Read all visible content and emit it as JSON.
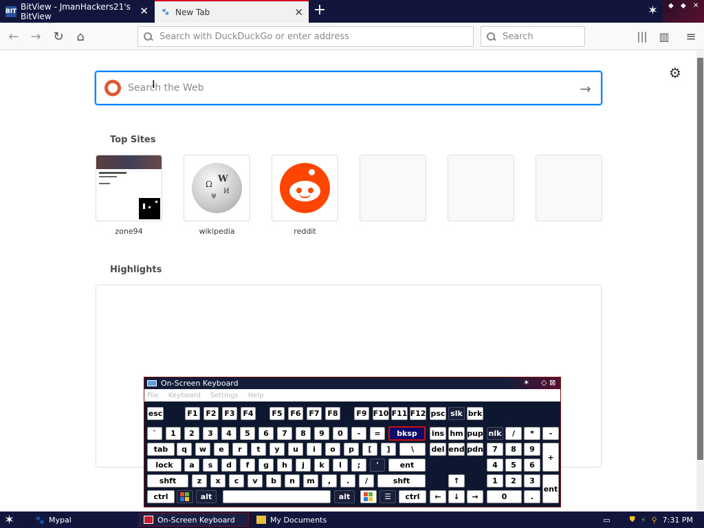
{
  "browser": {
    "tabs": [
      {
        "title": "BitView - JmanHackers21's BitView",
        "favicon_text": "BIT"
      },
      {
        "title": "New Tab"
      }
    ],
    "urlbar_placeholder": "Search with DuckDuckGo or enter address",
    "searchbar_placeholder": "Search"
  },
  "newtab": {
    "search_placeholder": "Search the Web",
    "top_sites_title": "Top Sites",
    "top_sites": [
      {
        "label": "zone94"
      },
      {
        "label": "wikipedia"
      },
      {
        "label": "reddit"
      }
    ],
    "highlights_title": "Highlights"
  },
  "osk": {
    "title": "On-Screen Keyboard",
    "menu": [
      "File",
      "Keyboard",
      "Settings",
      "Help"
    ],
    "keys": {
      "esc": "esc",
      "f1": "F1",
      "f2": "F2",
      "f3": "F3",
      "f4": "F4",
      "f5": "F5",
      "f6": "F6",
      "f7": "F7",
      "f8": "F8",
      "f9": "F9",
      "f10": "F10",
      "f11": "F11",
      "f12": "F12",
      "psc": "psc",
      "slk": "slk",
      "brk": "brk",
      "backtick": "`",
      "d1": "1",
      "d2": "2",
      "d3": "3",
      "d4": "4",
      "d5": "5",
      "d6": "6",
      "d7": "7",
      "d8": "8",
      "d9": "9",
      "d0": "0",
      "minus": "-",
      "equals": "=",
      "bksp": "bksp",
      "ins": "ins",
      "hm": "hm",
      "pup": "pup",
      "nlk": "nlk",
      "np_slash": "/",
      "np_star": "*",
      "np_minus": "-",
      "tab": "tab",
      "q": "q",
      "w": "w",
      "e": "e",
      "r": "r",
      "t": "t",
      "y": "y",
      "u": "u",
      "i": "i",
      "o": "o",
      "p": "p",
      "lbracket": "[",
      "rbracket": "]",
      "backslash": "\\",
      "del": "del",
      "end": "end",
      "pdn": "pdn",
      "np7": "7",
      "np8": "8",
      "np9": "9",
      "np_plus": "+",
      "lock": "lock",
      "a": "a",
      "s": "s",
      "d": "d",
      "f": "f",
      "g": "g",
      "h": "h",
      "j": "j",
      "k": "k",
      "l": "l",
      "semicolon": ";",
      "quote": "'",
      "ent": "ent",
      "np4": "4",
      "np5": "5",
      "np6": "6",
      "lshft": "shft",
      "z": "z",
      "x": "x",
      "c": "c",
      "v": "v",
      "b": "b",
      "n": "n",
      "m": "m",
      "comma": ",",
      "period": ".",
      "slash": "/",
      "rshft": "shft",
      "up": "↑",
      "np1": "1",
      "np2": "2",
      "np3": "3",
      "np_ent": "ent",
      "lctrl": "ctrl",
      "lalt": "alt",
      "ralt": "alt",
      "rctrl": "ctrl",
      "left": "←",
      "down": "↓",
      "right": "→",
      "np0": "0",
      "np_dot": "."
    }
  },
  "taskbar": {
    "tasks": [
      {
        "label": "Mypal"
      },
      {
        "label": "On-Screen Keyboard"
      },
      {
        "label": "My Documents"
      }
    ],
    "clock": "7:31 PM"
  },
  "colors": {
    "accent": "#0a84ff",
    "titlebar": "#12163c",
    "tab_active_border": "#d70022",
    "reddit": "#ff4500",
    "ddg": "#de5833"
  }
}
